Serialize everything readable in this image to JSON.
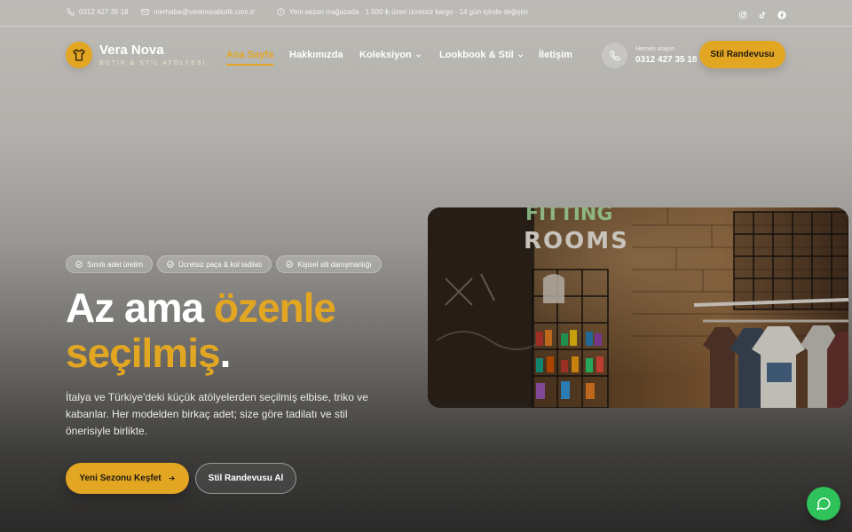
{
  "topbar": {
    "phone": "0312 427 35 18",
    "email": "merhaba@veranovabutik.com.tr",
    "notice": "Yeni sezon mağazada · 1.500 ₺ üzeri ücretsiz kargo · 14 gün içinde değişim",
    "social": [
      "instagram-icon",
      "tiktok-icon",
      "facebook-icon"
    ]
  },
  "brand": {
    "name": "Vera Nova",
    "tagline": "BUTİK & STİL ATÖLYESİ"
  },
  "nav": {
    "items": [
      {
        "label": "Ana Sayfa",
        "active": true
      },
      {
        "label": "Hakkımızda"
      },
      {
        "label": "Koleksiyon",
        "dropdown": true
      },
      {
        "label": "Lookbook & Stil",
        "dropdown": true
      },
      {
        "label": "İletişim"
      }
    ]
  },
  "header_contact": {
    "label": "Hemen arayın",
    "number": "0312 427 35 18"
  },
  "header_cta": "Stil Randevusu",
  "hero": {
    "chips": [
      "Sınırlı adet üretim",
      "Ücretsiz paça & kol tadilatı",
      "Kişisel stil danışmanlığı"
    ],
    "headline_part1": "Az ama ",
    "headline_highlight1": "özenle",
    "headline_highlight2": "seçilmiş",
    "headline_end": ".",
    "description": "İtalya ve Türkiye'deki küçük atölyelerden seçilmiş elbise, triko ve kabanlar. Her modelden birkaç adet; size göre tadilatı ve stil önerisiyle birlikte.",
    "primary_button": "Yeni Sezonu Keşfet",
    "secondary_button": "Stil Randevusu Al",
    "image_sign_top": "FITTING",
    "image_sign_bottom": "ROOMS"
  },
  "colors": {
    "accent": "#e3a623",
    "chat": "#2fc15a"
  }
}
